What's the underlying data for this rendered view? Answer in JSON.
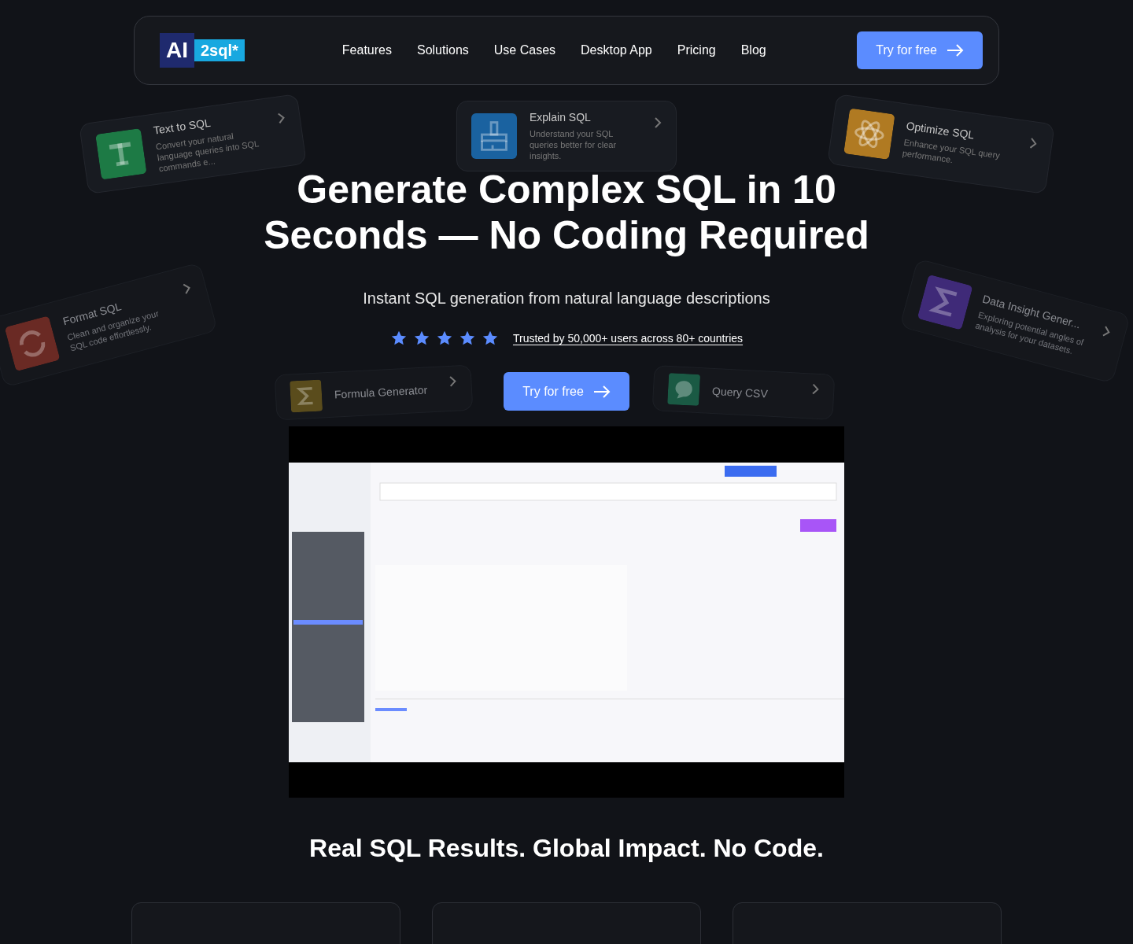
{
  "nav": {
    "logo": {
      "left": "AI",
      "right": "2sql*"
    },
    "links": [
      "Features",
      "Solutions",
      "Use Cases",
      "Desktop App",
      "Pricing",
      "Blog"
    ],
    "cta": "Try for free"
  },
  "floating_cards": [
    {
      "title": "Text to SQL",
      "description": "Convert your natural language queries into SQL commands e...",
      "kind": "letter",
      "color": "#1d7a45"
    },
    {
      "title": "Explain SQL",
      "description": "Understand your SQL queries better for clear insights.",
      "kind": "brush",
      "color": "#1a62a0"
    },
    {
      "title": "Optimize SQL",
      "description": "Enhance your SQL query performance.",
      "kind": "atom",
      "color": "#b07a22"
    },
    {
      "title": "Format SQL",
      "description": "Clean and organize your SQL code effortlessly.",
      "kind": "refresh",
      "color": "#6a2a24"
    },
    {
      "title": "Formula Generator",
      "kind": "sigma",
      "color": "#5a4c1c"
    },
    {
      "title": "Query CSV",
      "kind": "chat",
      "color": "#1a5a44"
    },
    {
      "title": "Data Insight Gener...",
      "description": "Exploring potential angles of analysis for your datasets.",
      "kind": "sigma",
      "color": "#3f2a78"
    }
  ],
  "hero": {
    "title_lines": [
      "Generate Complex SQL in 10",
      "Seconds — No Coding Required"
    ],
    "subtitle": "Instant SQL generation from natural language descriptions",
    "stars": 5,
    "trust": "Trusted by 50,000+ users across 80+ countries",
    "cta": "Try for free"
  },
  "section": {
    "heading": "Real SQL Results. Global Impact. No Code."
  }
}
